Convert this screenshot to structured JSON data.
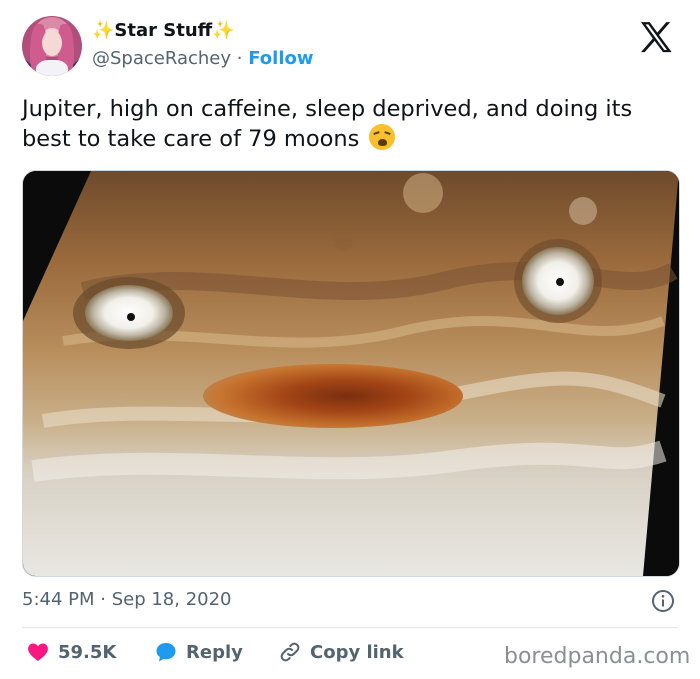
{
  "author": {
    "sparkle_left": "✨",
    "name": "Star Stuff",
    "sparkle_right": "✨",
    "handle": "@SpaceRachey",
    "separator": "·",
    "follow_label": "Follow"
  },
  "platform_icon": "x-logo-icon",
  "tweet": {
    "text": "Jupiter, high on caffeine, sleep deprived, and doing its best to take care of 79 moons",
    "emoji": "weary-face-emoji",
    "image": "Jupiter clouds resembling a surprised face"
  },
  "meta": {
    "timestamp": "5:44 PM · Sep 18, 2020",
    "info_icon": "info-icon"
  },
  "actions": {
    "likes": "59.5K",
    "reply_label": "Reply",
    "copy_link_label": "Copy link"
  },
  "watermark": "boredpanda.com",
  "colors": {
    "accent": "#1d9bf0",
    "like": "#f91880",
    "muted": "#536471",
    "text": "#0f1419"
  }
}
